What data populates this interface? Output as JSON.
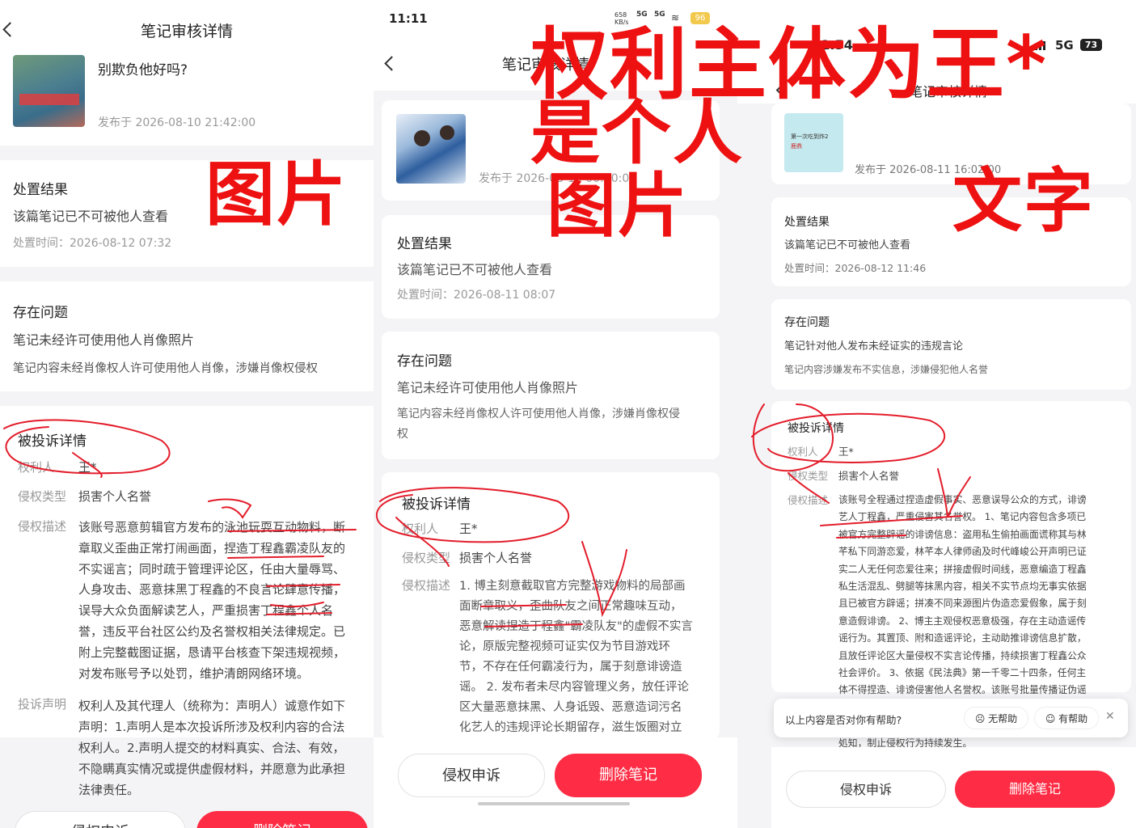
{
  "panel1": {
    "header": "笔记审核详情",
    "note_title": "别欺负他好吗?",
    "published": "发布于 2026-08-10 21:42:00",
    "result_title": "处置结果",
    "result_text": "该篇笔记已不可被他人查看",
    "handle_time": "处置时间：2026-08-12 07:32",
    "issue_title": "存在问题",
    "issue_text": "笔记未经许可使用他人肖像照片",
    "issue_desc": "笔记内容未经肖像权人许可使用他人肖像，涉嫌肖像权侵权",
    "complaint_title": "被投诉详情",
    "owner_label": "权利人",
    "owner_value": "王*",
    "type_label": "侵权类型",
    "type_value": "损害个人名誉",
    "desc_label": "侵权描述",
    "desc_lines": [
      "该账号恶意剪辑官方发布的泳池玩耍互动物料，断",
      "章取义歪曲正常打闹画面，捏造丁程鑫霸凌队友的",
      "不实谣言；同时疏于管理评论区，任由大量辱骂、",
      "人身攻击、恶意抹黑丁程鑫的不良言论肆意传播，",
      "误导大众负面解读艺人，严重损害丁程鑫个人名",
      "誉，违反平台社区公约及名誉权相关法律规定。已",
      "附上完整截图证据，恳请平台核查下架违规视频，",
      "对发布账号予以处罚，维护清朗网络环境。"
    ],
    "statement_label": "投诉声明",
    "statement_lines": [
      "权利人及其代理人（统称为：声明人）诚意作如下",
      "声明：1.声明人是本次投诉所涉及权利内容的合法",
      "权利人。2.声明人提交的材料真实、合法、有效，",
      "不隐瞒真实情况或提供虚假材料，并愿意为此承担",
      "法律责任。"
    ],
    "btn_appeal": "侵权申诉",
    "btn_delete": "删除笔记",
    "annotation": "图片"
  },
  "panel2": {
    "status_time": "11:11",
    "status_speed": "658 KB/s",
    "status_net1": "5G",
    "status_net2": "5G",
    "battery": "96",
    "header": "笔记审核详情",
    "published": "发布于 2026-08-10 00:00:00",
    "result_title": "处置结果",
    "result_text": "该篇笔记已不可被他人查看",
    "handle_time": "处置时间：2026-08-11 08:07",
    "issue_title": "存在问题",
    "issue_text": "笔记未经许可使用他人肖像照片",
    "issue_desc_lines": [
      "笔记内容未经肖像权人许可使用他人肖像，涉嫌肖像权侵",
      "权"
    ],
    "complaint_title": "被投诉详情",
    "owner_label": "权利人",
    "owner_value": "王*",
    "type_label": "侵权类型",
    "type_value": "损害个人名誉",
    "desc_label": "侵权描述",
    "desc_lines": [
      "1. 博主刻意截取官方完整游戏物料的局部画",
      "面断章取义，歪曲队友之间正常趣味互动，",
      "恶意解读捏造丁程鑫\"霸凌队友\"的虚假不实言",
      "论，原版完整视频可证实仅为节目游戏环",
      "节，不存在任何霸凌行为，属于刻意诽谤造",
      "谣。 2. 发布者未尽内容管理义务，放任评论",
      "区大量恶意抹黑、人身诋毁、恶意造词污名",
      "化艺人的违规评论长期留存，滋生饭圈对立"
    ],
    "btn_appeal": "侵权申诉",
    "btn_delete": "删除笔记",
    "annotation_line1": "权利主体为王*",
    "annotation_line2": "是个人",
    "annotation_line3": "图片"
  },
  "panel3": {
    "status_time": "11:54",
    "status_net": "5G",
    "battery": "73",
    "header": "笔记审核详情",
    "thumb_text": "第一次吃到炸2",
    "thumb_text2": "鹿鼎",
    "published": "发布于 2026-08-11 16:02:00",
    "result_title": "处置结果",
    "result_text": "该篇笔记已不可被他人查看",
    "handle_time": "处置时间：2026-08-12 11:46",
    "issue_title": "存在问题",
    "issue_text": "笔记针对他人发布未经证实的违规言论",
    "issue_desc": "笔记内容涉嫌发布不实信息，涉嫌侵犯他人名誉",
    "complaint_title": "被投诉详情",
    "owner_label": "权利人",
    "owner_value": "王*",
    "type_label": "侵权类型",
    "type_value": "损害个人名誉",
    "desc_label": "侵权描述",
    "desc_lines": [
      "该账号全程通过捏造虚假事实、恶意误导公众的方式，诽谤",
      "艺人丁程鑫，严重侵害其名誉权。 1、笔记内容包含多项已",
      "被官方完整辟谣的诽谤信息：盗用私生偷拍画面谎称其与林",
      "芊私下同游恋爱，林芊本人律师函及时代峰峻公开声明已证",
      "实二人无任何恋爱往来；拼接虚假时间线，恶意编造丁程鑫",
      "私生活混乱、劈腿等抹黑内容，相关不实节点均无事实依据",
      "且已被官方辟谣；拼凑不同来源图片伪造恋爱假象，属于刻",
      "意造假诽谤。 2、博主主观侵权恶意极强，存在主动造谣传",
      "谣行为。其置顶、附和造谣评论，主动助推诽谤信息扩散，",
      "且放任评论区大量侵权不实言论传播，持续损害丁程鑫公众",
      "社会评价。 3、依据《民法典》第一千零二十四条，任何主",
      "体不得捏造、诽谤侵害他人名誉权。该账号批量传播证伪谣"
    ],
    "desc_tail": "処知，制止侵权行为持续发生。",
    "feedback_q": "以上内容是否对你有帮助?",
    "feedback_no": "无帮助",
    "feedback_yes": "有帮助",
    "btn_appeal": "侵权申诉",
    "btn_delete": "删除笔记",
    "annotation": "文字"
  }
}
